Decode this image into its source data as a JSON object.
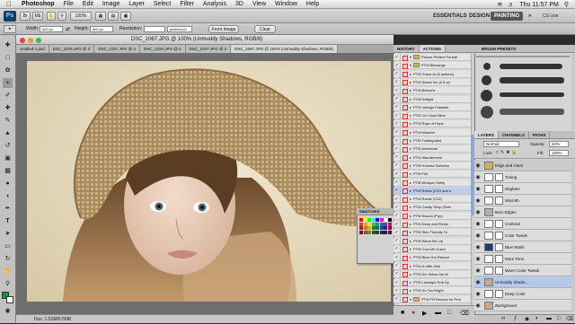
{
  "menubar": {
    "app": "Photoshop",
    "items": [
      "File",
      "Edit",
      "Image",
      "Layer",
      "Select",
      "Filter",
      "Analysis",
      "3D",
      "View",
      "Window",
      "Help"
    ],
    "clock": "Thu 11:57 PM",
    "cs_live": "CS Live"
  },
  "appbar": {
    "logo": "Ps",
    "zoom": "100%",
    "workspaces": [
      "ESSENTIALS",
      "DESIGN",
      "PAINTING"
    ],
    "active_workspace": "PAINTING"
  },
  "options": {
    "width_label": "Width:",
    "width_value": "600 px",
    "height_label": "Height:",
    "height_value": "600 px",
    "resolution_label": "Resolution:",
    "resolution_unit": "pixels/inch",
    "front_image": "Front Image",
    "clear": "Clear"
  },
  "document": {
    "title": "DSC_1067.JPG @ 100% (Unmuddy Shadows, RGB/8)",
    "tabs": [
      {
        "label": "Untitled-1.psd",
        "active": false
      },
      {
        "label": "DSC_1075.JPG @ 2",
        "active": false
      },
      {
        "label": "DSC_1037.JPG @ 2",
        "active": false
      },
      {
        "label": "DSC_1034.JPG @ 2",
        "active": false
      },
      {
        "label": "DSC_1037.JPG @ 2",
        "active": false
      },
      {
        "label": "DSC_1067.JPG @ 100% (Unmuddy Shadows, RGB/8)",
        "active": true
      }
    ],
    "status": "Doc: 1.51M/6.55M"
  },
  "history_panel": {
    "tabs": [
      "HISTORY",
      "ACTIONS"
    ],
    "active_tab": "ACTIONS",
    "actions": [
      {
        "label": "Picture Perfect Portrait",
        "type": "set",
        "selected": false
      },
      {
        "label": "PTM Blessings",
        "type": "set",
        "selected": false
      },
      {
        "label": "PTM Grace-fu (6 actions)",
        "type": "action",
        "selected": false
      },
      {
        "label": "PTM Sweet Inc (6 & w)",
        "type": "action",
        "selected": false
      },
      {
        "label": "PTM Beloved",
        "type": "action",
        "selected": false
      },
      {
        "label": "PTM Delight",
        "type": "action",
        "selected": false
      },
      {
        "label": "PTM Vintage Fairytale",
        "type": "action",
        "selected": false
      },
      {
        "label": "PTM On Cloud Nine",
        "type": "action",
        "selected": false
      },
      {
        "label": "PTM Rays of Hope",
        "type": "action",
        "selected": false
      },
      {
        "label": "PTM Miracles",
        "type": "action",
        "selected": false
      },
      {
        "label": "PTM Twitterpated",
        "type": "action",
        "selected": false
      },
      {
        "label": "PTM Ambience",
        "type": "action",
        "selected": false
      },
      {
        "label": "PTM Wanderment",
        "type": "action",
        "selected": false
      },
      {
        "label": "PTM Hushed Softness",
        "type": "action",
        "selected": false
      },
      {
        "label": "PTM Flirt",
        "type": "action",
        "selected": false
      },
      {
        "label": "PTM Whisper Softly",
        "type": "action",
        "selected": false
      },
      {
        "label": "PTM Resist (CS3 and a",
        "type": "action",
        "selected": true
      },
      {
        "label": "PTM Resist (CS2)",
        "type": "action",
        "selected": false
      },
      {
        "label": "PTM Candy Shop (Sele",
        "type": "action",
        "selected": false
      },
      {
        "label": "PTM Swoon (Pop)",
        "type": "action",
        "selected": false
      },
      {
        "label": "PTM Deep and Richer",
        "type": "action",
        "selected": false
      },
      {
        "label": "PTM Skin Friendly Gr",
        "type": "action",
        "selected": false
      },
      {
        "label": "PTM Warm Me Up",
        "type": "action",
        "selected": false
      },
      {
        "label": "PTM Cool Me Down",
        "type": "action",
        "selected": false
      },
      {
        "label": "PTM Blow Out Rescue",
        "type": "action",
        "selected": false
      },
      {
        "label": "PTM A Little Zest",
        "type": "action",
        "selected": false
      },
      {
        "label": "PTM De-Yellow the W",
        "type": "action",
        "selected": false
      },
      {
        "label": "PTM Limelight Soft Sp",
        "type": "action",
        "selected": false
      },
      {
        "label": "PTM It's Too Bright",
        "type": "action",
        "selected": false
      },
      {
        "label": "PTM FR Rescue for Prof",
        "type": "set",
        "selected": false
      }
    ]
  },
  "swatches": {
    "title": "SWATCHES",
    "colors": [
      "#ff0000",
      "#ffff00",
      "#00ff00",
      "#00ffff",
      "#0000ff",
      "#ff00ff",
      "#ffffff",
      "#000000",
      "#e53935",
      "#f4a030",
      "#f2e21a",
      "#5ab34a",
      "#1a9c6e",
      "#1a6fb8",
      "#6a3d9a",
      "#c2185b",
      "#b71c1c",
      "#e06a1a",
      "#c8b800",
      "#2e7d32",
      "#00796b",
      "#0d47a1",
      "#4a148c",
      "#880e4f",
      "#7f1010",
      "#a64b10",
      "#8a7f00",
      "#1b5e20",
      "#004d40",
      "#0a2f6b",
      "#2e0d60",
      "#5a0a35"
    ]
  },
  "brush_panel": {
    "title": "BRUSH PRESETS"
  },
  "layers_panel": {
    "tabs": [
      "LAYERS",
      "CHANNELS",
      "PATHS"
    ],
    "blend_mode": "Normal",
    "opacity_label": "Opacity:",
    "opacity": "63%",
    "lock_label": "Lock:",
    "fill_label": "Fill:",
    "fill": "100%",
    "layers": [
      {
        "name": "Edge and Clear",
        "kind": "group",
        "selected": false
      },
      {
        "name": "Toning",
        "kind": "adjustment",
        "selected": false
      },
      {
        "name": "Brighten",
        "kind": "adjustment",
        "selected": false
      },
      {
        "name": "Warmth",
        "kind": "adjustment",
        "selected": false
      },
      {
        "name": "Burn Edges",
        "kind": "pixel",
        "selected": false
      },
      {
        "name": "Contrast",
        "kind": "adjustment",
        "selected": false
      },
      {
        "name": "Color Tweak",
        "kind": "adjustment",
        "selected": false
      },
      {
        "name": "Blue Wash",
        "kind": "fill",
        "selected": false
      },
      {
        "name": "More Tone",
        "kind": "adjustment",
        "selected": false
      },
      {
        "name": "Warm Color Tweak",
        "kind": "adjustment",
        "selected": false
      },
      {
        "name": "Unmuddy Shado...",
        "kind": "photo",
        "selected": true
      },
      {
        "name": "Deep Color",
        "kind": "adjustment",
        "selected": false
      },
      {
        "name": "Background",
        "kind": "photo",
        "selected": false
      }
    ]
  }
}
